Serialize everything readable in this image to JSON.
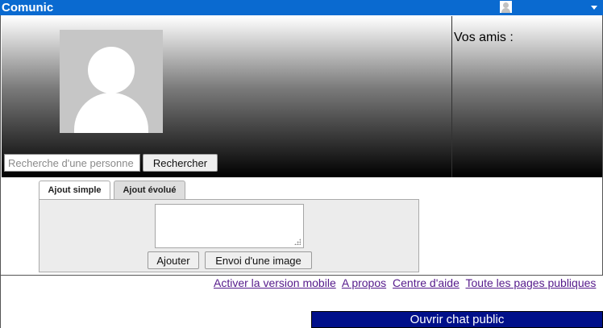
{
  "topbar": {
    "app_title": "Comunic",
    "user_avatar_icon": "user-avatar-icon",
    "menu_icon": "chevron-down-icon"
  },
  "profile": {
    "photo_icon": "default-user-avatar",
    "search": {
      "placeholder": "Recherche d'une personne",
      "value": ""
    },
    "search_button_label": "Rechercher"
  },
  "friends": {
    "title": "Vos amis :"
  },
  "post_composer": {
    "tabs": [
      {
        "label": "Ajout simple",
        "active": true
      },
      {
        "label": "Ajout évolué",
        "active": false
      }
    ],
    "textarea_value": "",
    "add_button_label": "Ajouter",
    "upload_button_label": "Envoi d'une image"
  },
  "footer": {
    "links": [
      {
        "label": "Activer la version mobile"
      },
      {
        "label": "A propos"
      },
      {
        "label": "Centre d'aide"
      },
      {
        "label": "Toute les pages publiques"
      }
    ]
  },
  "chat": {
    "label": "Ouvrir chat public"
  },
  "colors": {
    "topbar": "#0a6ad0",
    "chat_bar": "#00108a",
    "visited_link": "#551a8b"
  }
}
